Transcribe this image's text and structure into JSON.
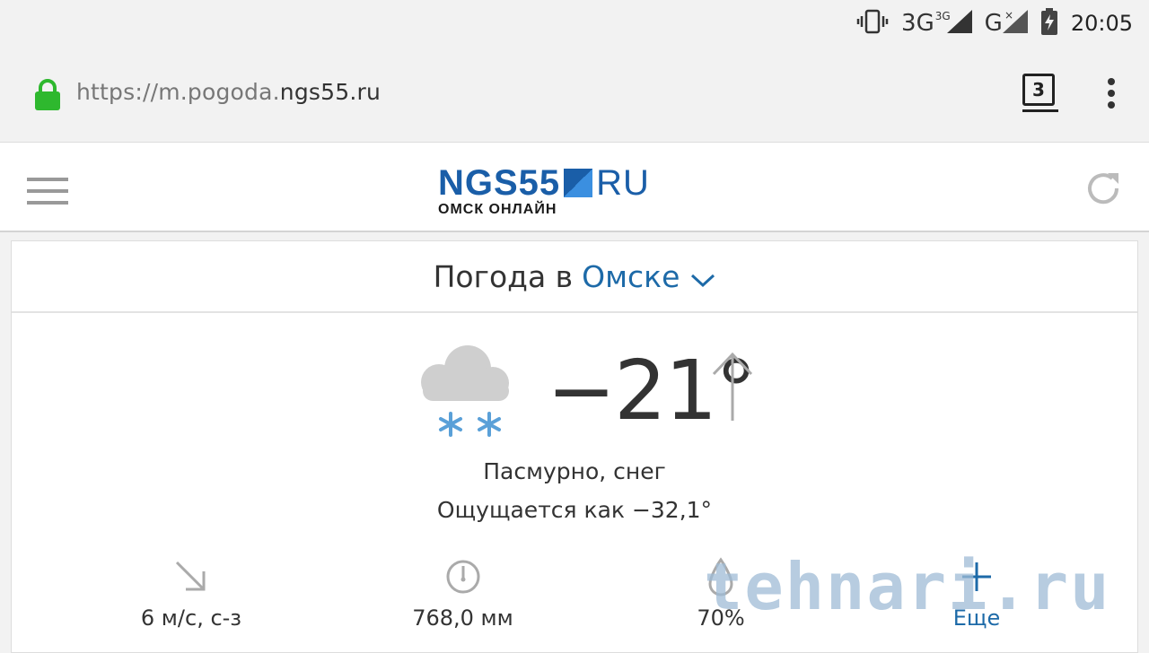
{
  "statusbar": {
    "time": "20:05",
    "network_primary": "3G",
    "network_primary_sup": "3G",
    "network_secondary": "G",
    "icons": [
      "vibrate-icon",
      "signal-3g-icon",
      "signal-g-icon",
      "battery-charging-icon"
    ]
  },
  "browser": {
    "url_prefix": "https://m.pogoda.",
    "url_host": "ngs55.ru",
    "tab_count": "3"
  },
  "site_header": {
    "logo_main": "NGS55",
    "logo_ru": "RU",
    "logo_sub": "ОМСК ОНЛАЙН"
  },
  "weather": {
    "title_prefix": "Погода в",
    "city": "Омске",
    "temperature": "−21°",
    "condition": "Пасмурно, снег",
    "feels_like": "Ощущается как −32,1°",
    "wind": "6 м/с, с-з",
    "pressure": "768,0 мм",
    "humidity": "70%",
    "more": "Еще"
  },
  "watermark": "tehnari.ru",
  "colors": {
    "accent": "#1d6aa8",
    "logo_blue": "#1a5ea8",
    "lock_green": "#2eb82e",
    "snow_blue": "#5aa0d8"
  }
}
